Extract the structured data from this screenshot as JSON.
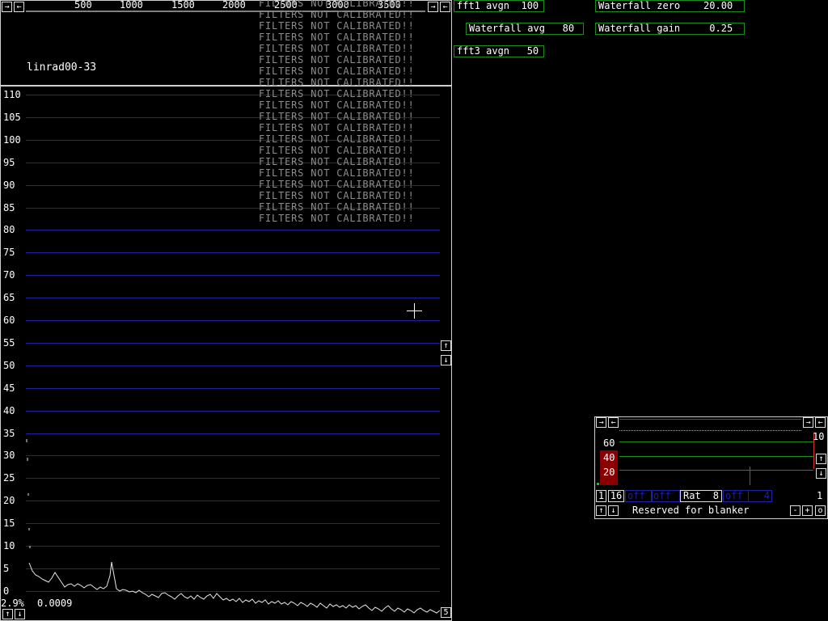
{
  "freq_scale": {
    "labels": [
      "500",
      "1000",
      "1500",
      "2000",
      "2500",
      "3000",
      "3500"
    ]
  },
  "program_title": "linrad00-33",
  "filters_warning": "FILTERS NOT CALIBRATED!!",
  "y_axis": {
    "labels": [
      "110",
      "105",
      "100",
      "95",
      "90",
      "85",
      "80",
      "75",
      "70",
      "65",
      "60",
      "55",
      "50",
      "45",
      "40",
      "35",
      "30",
      "25",
      "20",
      "15",
      "10",
      "5",
      "0"
    ]
  },
  "status": {
    "percent": "2.9%",
    "value": "0.0009",
    "right_box": "5"
  },
  "params": {
    "fft1_avgn": "fft1 avgn  100",
    "waterfall_avg": "Waterfall avg   80",
    "fft3_avgn": "fft3 avgn   50",
    "waterfall_zero": "Waterfall zero    20.00",
    "waterfall_gain": "Waterfall gain     0.25"
  },
  "blanker": {
    "scale": [
      "60",
      "40",
      "20"
    ],
    "right_top": "10",
    "row": {
      "b1": "1",
      "b2": "16",
      "off1": "off",
      "off2": "off",
      "rat_label": "Rat",
      "rat_value": "8",
      "off3": "off",
      "num4": "4",
      "right": "1"
    },
    "reserved": "Reserved for blanker",
    "minus": "-",
    "plus": "+",
    "o": "o"
  },
  "icons": {
    "arrow_right": "→",
    "arrow_left": "←",
    "arrow_up": "↑",
    "arrow_down": "↓"
  },
  "colors": {
    "grid": "#1f1f9f",
    "param_border": "#1c8a1c",
    "filters_text": "#8c8c8c",
    "blanker_highlight": "#8a0000"
  }
}
